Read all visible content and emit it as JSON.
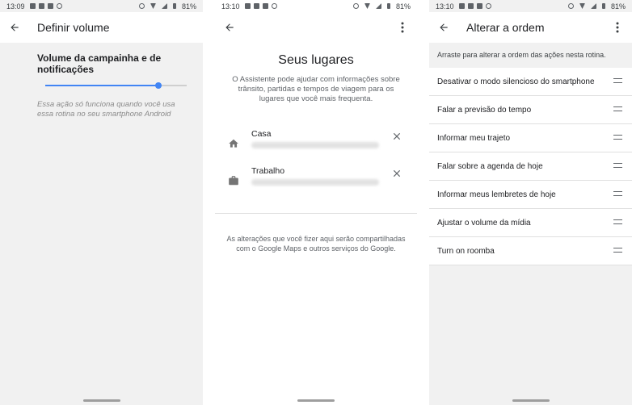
{
  "screens": {
    "volume": {
      "status": {
        "time": "13:09",
        "battery": "81%"
      },
      "title": "Definir volume",
      "setting_label": "Volume da campainha e de notificações",
      "slider_value_fraction": 0.8,
      "note": "Essa ação só funciona quando você usa essa rotina no seu smartphone Android"
    },
    "places": {
      "status": {
        "time": "13:10",
        "battery": "81%"
      },
      "title": "Seus lugares",
      "description": "O Assistente pode ajudar com informações sobre trânsito, partidas e tempos de viagem para os lugares que você mais frequenta.",
      "items": [
        {
          "name": "Casa",
          "icon": "home-icon"
        },
        {
          "name": "Trabalho",
          "icon": "briefcase-icon"
        }
      ],
      "footer": "As alterações que você fizer aqui serão compartilhadas com o Google Maps e outros serviços do Google."
    },
    "reorder": {
      "status": {
        "time": "13:10",
        "battery": "81%"
      },
      "title": "Alterar a ordem",
      "hint": "Arraste para alterar a ordem das ações nesta rotina.",
      "items": [
        "Desativar o modo silencioso do smartphone",
        "Falar a previsão do tempo",
        "Informar meu trajeto",
        "Falar sobre a agenda de hoje",
        "Informar meus lembretes de hoje",
        "Ajustar o volume da mídia",
        "Turn on roomba"
      ]
    }
  },
  "colors": {
    "accent": "#4285f4",
    "panel_bg": "#f1f1f1",
    "text": "#202124",
    "muted": "#5f6368"
  }
}
